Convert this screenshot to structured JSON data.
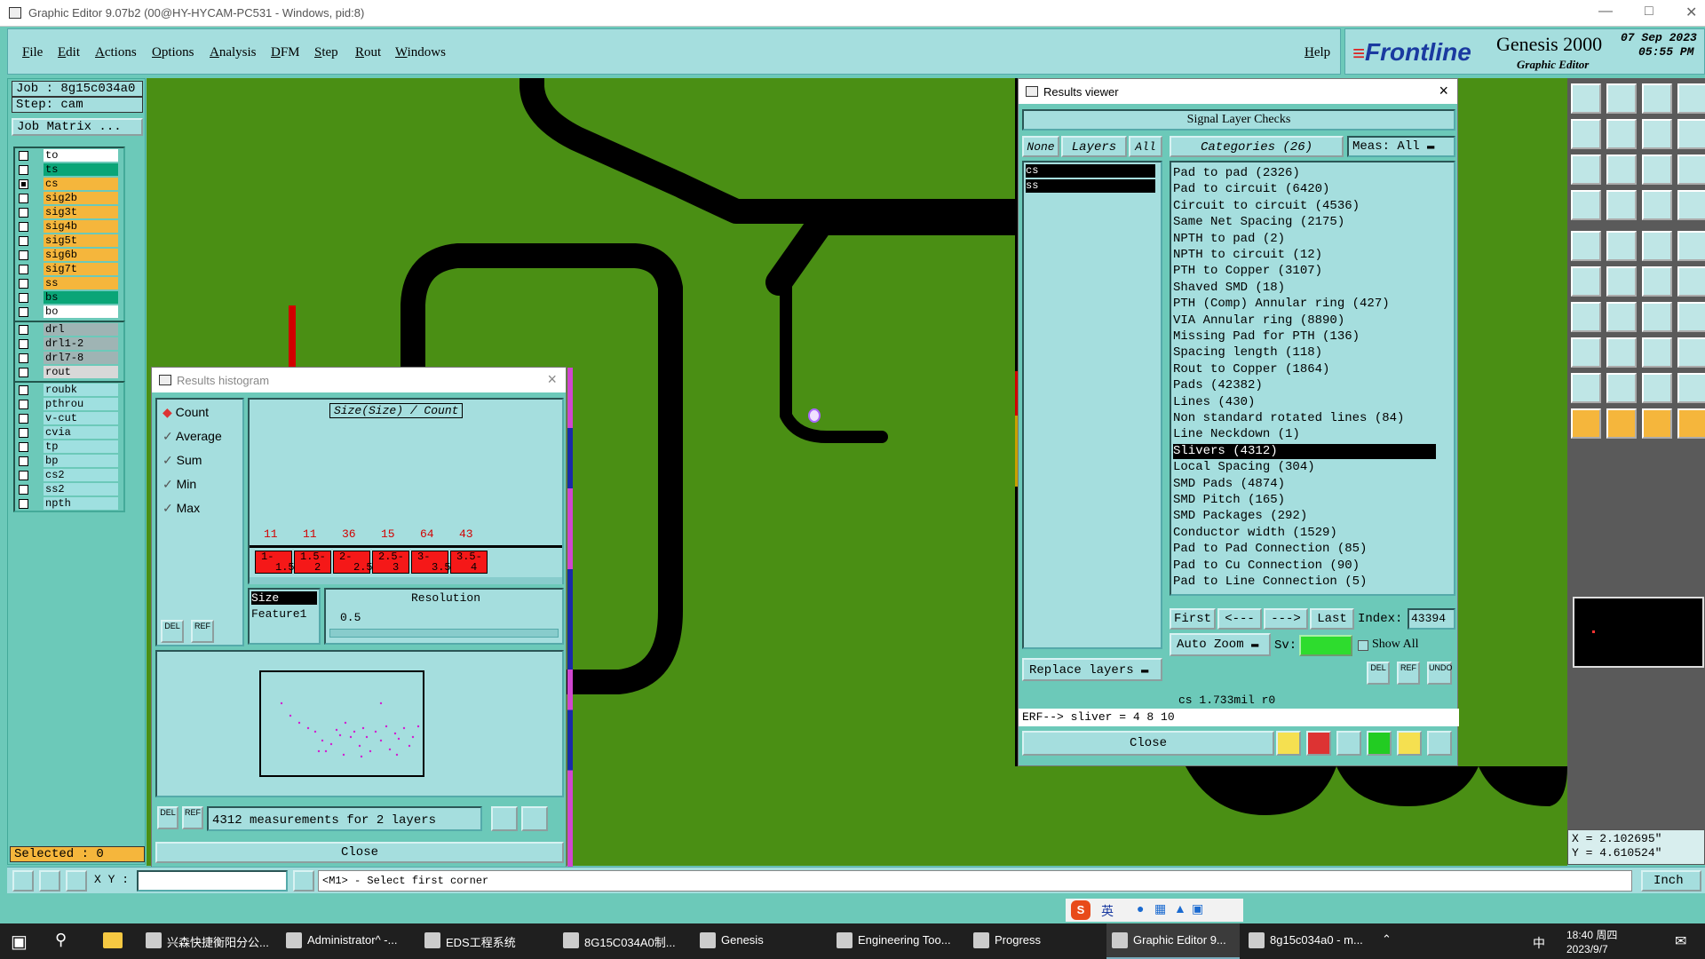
{
  "titlebar": {
    "title": "Graphic Editor 9.07b2 (00@HY-HYCAM-PC531 - Windows, pid:8)"
  },
  "menubar": {
    "items": [
      "File",
      "Edit",
      "Actions",
      "Options",
      "Analysis",
      "DFM",
      "Step",
      "Rout",
      "Windows"
    ],
    "help": "Help"
  },
  "brand": {
    "logo": "Frontline",
    "product": "Genesis 2000",
    "subtitle": "Graphic Editor",
    "date": "07 Sep 2023",
    "time": "05:55 PM"
  },
  "job": {
    "job_label": "Job : 8g15c034a0",
    "step_label": "Step: cam",
    "matrix_button": "Job Matrix ...",
    "selected": "Selected : 0"
  },
  "layers": {
    "group1": [
      {
        "name": "to",
        "color": "#ffffff",
        "checked": false
      },
      {
        "name": "ts",
        "color": "#0aa577",
        "checked": false
      },
      {
        "name": "cs",
        "color": "#f5b63c",
        "checked": true
      },
      {
        "name": "sig2b",
        "color": "#f5b63c",
        "checked": false
      },
      {
        "name": "sig3t",
        "color": "#f5b63c",
        "checked": false
      },
      {
        "name": "sig4b",
        "color": "#f5b63c",
        "checked": false
      },
      {
        "name": "sig5t",
        "color": "#f5b63c",
        "checked": false
      },
      {
        "name": "sig6b",
        "color": "#f5b63c",
        "checked": false
      },
      {
        "name": "sig7t",
        "color": "#f5b63c",
        "checked": false
      },
      {
        "name": "ss",
        "color": "#f5b63c",
        "checked": false
      },
      {
        "name": "bs",
        "color": "#0aa577",
        "checked": false
      },
      {
        "name": "bo",
        "color": "#ffffff",
        "checked": false
      }
    ],
    "group2": [
      {
        "name": "drl",
        "color": "#9fb4b4"
      },
      {
        "name": "drl1-2",
        "color": "#9fb4b4"
      },
      {
        "name": "drl7-8",
        "color": "#9fb4b4"
      },
      {
        "name": "rout",
        "color": "#d8d8d8"
      }
    ],
    "group3": [
      {
        "name": "roubk",
        "color": "#9fe0e0"
      },
      {
        "name": "pthrou",
        "color": "#9fe0e0"
      },
      {
        "name": "v-cut",
        "color": "#9fe0e0"
      },
      {
        "name": "cvia",
        "color": "#9fe0e0"
      },
      {
        "name": "tp",
        "color": "#9fe0e0"
      },
      {
        "name": "bp",
        "color": "#9fe0e0"
      },
      {
        "name": "cs2",
        "color": "#9fe0e0"
      },
      {
        "name": "ss2",
        "color": "#9fe0e0"
      },
      {
        "name": "npth",
        "color": "#9fe0e0"
      }
    ]
  },
  "histogram": {
    "title": "Results histogram",
    "options": [
      "Count",
      "Average",
      "Sum",
      "Min",
      "Max"
    ],
    "chart_title": "Size(Size) / Count",
    "counts": [
      "11",
      "11",
      "36",
      "15",
      "64",
      "43"
    ],
    "bins": [
      [
        "1-",
        "1.5"
      ],
      [
        "1.5-",
        "2"
      ],
      [
        "2-",
        "2.5"
      ],
      [
        "2.5-",
        "3"
      ],
      [
        "3-",
        "3.5"
      ],
      [
        "3.5-",
        "4"
      ]
    ],
    "list": [
      "Size",
      "Feature1"
    ],
    "resolution_label": "Resolution",
    "resolution_value": "0.5",
    "summary": "4312 measurements for 2 layers",
    "close": "Close",
    "del": "DEL",
    "ref": "REF"
  },
  "results": {
    "title": "Results viewer",
    "header": "Signal Layer Checks",
    "btn_none": "None",
    "btn_layers": "Layers",
    "btn_all": "All",
    "categories_label": "Categories (26)",
    "meas_label": "Meas:",
    "meas_value": "All",
    "layers": [
      "cs",
      "ss"
    ],
    "categories": [
      "Pad to pad (2326)",
      "Pad to circuit (6420)",
      "Circuit to circuit (4536)",
      "Same Net Spacing (2175)",
      "NPTH to pad (2)",
      "NPTH to circuit (12)",
      "PTH to Copper (3107)",
      "Shaved SMD (18)",
      "PTH (Comp) Annular ring (427)",
      "VIA Annular ring (8890)",
      "Missing Pad for PTH (136)",
      "Spacing length (118)",
      "Rout to Copper (1864)",
      "Pads (42382)",
      "Lines (430)",
      "Non standard rotated lines (84)",
      "Line Neckdown (1)",
      "Slivers (4312)",
      "Local Spacing (304)",
      "SMD Pads (4874)",
      "SMD Pitch (165)",
      "SMD Packages (292)",
      "Conductor width (1529)",
      "Pad to Pad Connection (85)",
      "Pad to Cu Connection (90)",
      "Pad to Line Connection (5)"
    ],
    "first": "First",
    "prev": "<---",
    "next": "--->",
    "last": "Last",
    "index_label": "Index:",
    "index_value": "43394",
    "autozoom": "Auto Zoom",
    "sv_label": "Sv:",
    "showall": "Show All",
    "replace": "Replace layers",
    "info": "cs 1.733mil  r0",
    "erf": "ERF--> sliver = 4 8 10",
    "close": "Close",
    "del": "DEL",
    "ref": "REF",
    "undo": "UNDO"
  },
  "coords": {
    "x": "X = 2.102695\"",
    "y": "Y = 4.610524\""
  },
  "status": {
    "xy": "X Y :",
    "msg": "<M1> - Select first corner",
    "unit": "Inch"
  },
  "taskbar": {
    "items": [
      "兴森快捷衡阳分公...",
      "Administrator^ -...",
      "EDS工程系统",
      "8G15C034A0制...",
      "Genesis",
      "Engineering Too...",
      "Progress",
      "Graphic Editor 9...",
      "8g15c034a0 - m..."
    ],
    "time": "18:40 周四",
    "date": "2023/9/7",
    "lang": "中"
  },
  "ime": {
    "lang": "英"
  }
}
